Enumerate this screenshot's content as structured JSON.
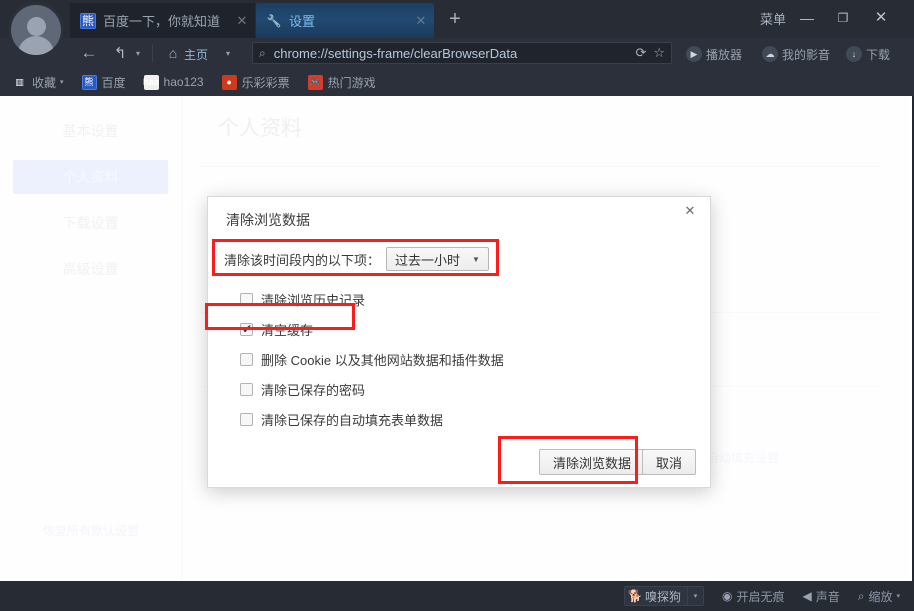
{
  "window": {
    "menu_label": "菜单",
    "minimize_label": "—",
    "maximize_label": "❐",
    "close_label": "✕",
    "newtab_label": "+"
  },
  "tabs": [
    {
      "title": "百度一下，你就知道",
      "favicon": "baidu-paw-icon",
      "close": "✕",
      "active": false
    },
    {
      "title": "设置",
      "favicon": "wrench-icon",
      "close": "✕",
      "active": true
    }
  ],
  "nav": {
    "back_icon": "←",
    "forward_icon": "↰",
    "forward_caret": "▾",
    "home_icon": "⌂",
    "home_label": "主页",
    "home_caret": "▾",
    "search_icon": "⌕",
    "url": "chrome://settings-frame/clearBrowserData",
    "reload_icon": "⟳",
    "star_icon": "☆",
    "buttons": [
      {
        "label": "播放器",
        "icon": "▶"
      },
      {
        "label": "我的影音",
        "icon": "☁"
      },
      {
        "label": "下载",
        "icon": "↓"
      }
    ]
  },
  "bookmarks": [
    {
      "label": "收藏",
      "icon": "book-icon",
      "caret": "▾"
    },
    {
      "label": "百度",
      "icon": "baidu-paw-icon",
      "caret": ""
    },
    {
      "label": "hao123",
      "icon": "hao-icon",
      "caret": ""
    },
    {
      "label": "乐彩彩票",
      "icon": "lecai-icon",
      "caret": ""
    },
    {
      "label": "热门游戏",
      "icon": "game-icon",
      "caret": ""
    }
  ],
  "settings": {
    "sidebar": [
      {
        "label": "基本设置",
        "selected": false
      },
      {
        "label": "个人资料",
        "selected": true
      },
      {
        "label": "下载设置",
        "selected": false
      },
      {
        "label": "高级设置",
        "selected": false
      }
    ],
    "reset_label": "恢复所有默认设置",
    "page_title": "个人资料",
    "background_text": "自动填充设置"
  },
  "dialog": {
    "title": "清除浏览数据",
    "close_label": "✕",
    "time_label": "清除该时间段内的以下项：",
    "time_value": "过去一小时",
    "time_caret": "▼",
    "checkboxes": [
      {
        "label": "清除浏览历史记录",
        "checked": false
      },
      {
        "label": "清空缓存",
        "checked": true
      },
      {
        "label": "删除 Cookie 以及其他网站数据和插件数据",
        "checked": false
      },
      {
        "label": "清除已保存的密码",
        "checked": false
      },
      {
        "label": "清除已保存的自动填充表单数据",
        "checked": false
      }
    ],
    "confirm_label": "清除浏览数据",
    "cancel_label": "取消"
  },
  "highlight_color": "#fb1c1c",
  "statusbar": {
    "sniffer": {
      "label": "嗅探狗",
      "icon": "dog-icon",
      "caret": "▾"
    },
    "items": [
      {
        "label": "开启无痕",
        "icon": "◉"
      },
      {
        "label": "声音",
        "icon": "◀"
      },
      {
        "label": "缩放",
        "icon": "⌕",
        "caret": "▾"
      }
    ]
  }
}
